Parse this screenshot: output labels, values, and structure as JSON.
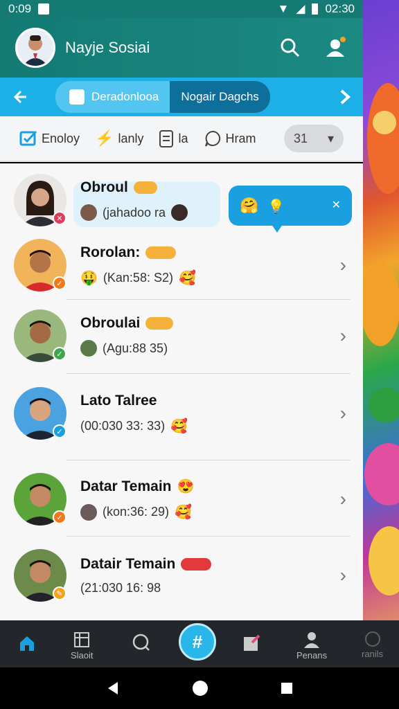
{
  "status_bar": {
    "time_left": "0:09",
    "time_right": "02:30"
  },
  "header": {
    "app_title": "Nayje Sosiai"
  },
  "tabbar": {
    "tabs": [
      {
        "label": "Deradonlooa"
      },
      {
        "label": "Nogair Dagchs"
      }
    ]
  },
  "filters": {
    "items": [
      {
        "label": "Enoloy"
      },
      {
        "label": "lanly"
      },
      {
        "label": "la"
      },
      {
        "label": "Hram"
      }
    ],
    "count_pill": "31"
  },
  "contacts": [
    {
      "name": "Obroul",
      "tag": "",
      "subtitle": "(jahadoo ra"
    },
    {
      "name": "Rorolan:",
      "tag": "",
      "subtitle": "(Kan:58: S2)"
    },
    {
      "name": "Obroulai",
      "tag": "",
      "subtitle": "(Agu:88 35)"
    },
    {
      "name": "Lato Talree",
      "tag": "",
      "subtitle": "(00:030  33: 33)"
    },
    {
      "name": "Datar Temain",
      "tag": "",
      "subtitle": "(kon:36: 29)"
    },
    {
      "name": "Datair Temain",
      "tag": "",
      "subtitle": "(21:030  16: 98"
    }
  ],
  "bottom_nav": {
    "items": [
      {
        "label": ""
      },
      {
        "label": "Slaoit"
      },
      {
        "label": ""
      },
      {
        "label": ""
      },
      {
        "label": ""
      },
      {
        "label": "Penans"
      },
      {
        "label": "ranils"
      }
    ]
  },
  "colors": {
    "primary": "#137a74",
    "accent": "#1cb0e6",
    "tag_yellow": "#f4b23a",
    "tag_red": "#e23a3a"
  }
}
